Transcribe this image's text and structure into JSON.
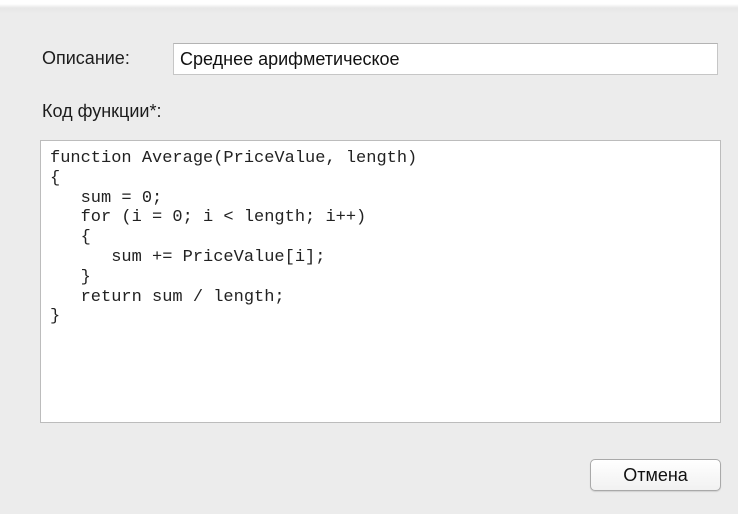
{
  "form": {
    "description_label": "Описание:",
    "description_value": "Среднее арифметическое",
    "code_label": "Код функции*:",
    "code_value": "function Average(PriceValue, length)\n{\n   sum = 0;\n   for (i = 0; i < length; i++)\n   {\n      sum += PriceValue[i];\n   }\n   return sum / length;\n}"
  },
  "buttons": {
    "cancel_label": "Отмена"
  }
}
